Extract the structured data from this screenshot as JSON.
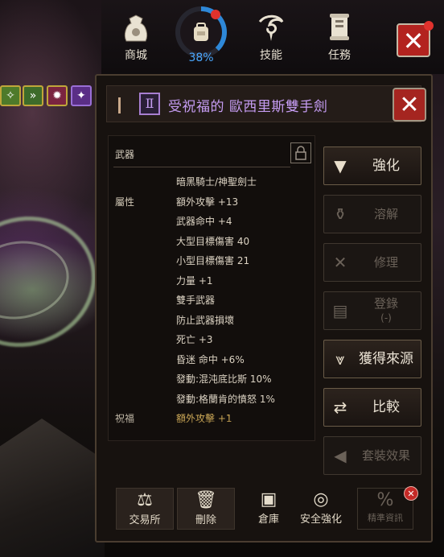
{
  "topbar": {
    "shop": {
      "label": "商城",
      "icon": "shop-bag-icon"
    },
    "gauge": {
      "percent_text": "38%",
      "value": 0.38,
      "icon": "backpack-icon"
    },
    "skills": {
      "label": "技能",
      "icon": "skill-swirl-icon"
    },
    "quests": {
      "label": "任務",
      "icon": "quest-scroll-icon"
    },
    "close_glyph": "✕"
  },
  "item": {
    "grade": "Ⅱ",
    "name": "受祝福的 歐西里斯雙手劍",
    "name_color": "#c59cf2",
    "close_glyph": "✕"
  },
  "stats": {
    "header": "武器",
    "rows": [
      {
        "label": "",
        "value": "暗黑騎士/神聖劍士"
      },
      {
        "label": "屬性",
        "value": "額外攻擊 +13"
      },
      {
        "label": "",
        "value": "武器命中 +4"
      },
      {
        "label": "",
        "value": "大型目標傷害 40"
      },
      {
        "label": "",
        "value": "小型目標傷害 21"
      },
      {
        "label": "",
        "value": "力量 +1"
      },
      {
        "label": "",
        "value": "雙手武器"
      },
      {
        "label": "",
        "value": "防止武器損壞"
      },
      {
        "label": "",
        "value": "死亡 +3"
      },
      {
        "label": "",
        "value": "昏迷 命中 +6%"
      },
      {
        "label": "",
        "value": "發動:混沌底比斯 10%"
      },
      {
        "label": "",
        "value": "發動:格蘭肯的憤怒 1%"
      },
      {
        "label": "祝福",
        "value": "額外攻擊 +1"
      }
    ]
  },
  "actions": {
    "enhance": "強化",
    "dissolve": "溶解",
    "repair": "修理",
    "register": "登錄",
    "register_sub": "(-)",
    "source": "獲得來源",
    "compare": "比較",
    "set_effect": "套裝效果"
  },
  "bottom": {
    "exchange": "交易所",
    "delete": "刪除",
    "storage": "倉庫",
    "safe_enhance": "安全強化",
    "fine_info": "精準資訊"
  },
  "colors": {
    "accent_red": "#b3231f",
    "gauge_blue": "#2e88d8",
    "grade_purple": "#a87fd2",
    "blessed_gold": "#d8b25c"
  }
}
